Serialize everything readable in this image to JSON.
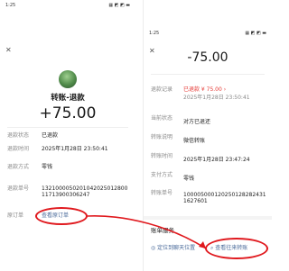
{
  "left": {
    "status_time": "1:25",
    "status_icons": "▦ ◩ ◩ ▬",
    "title": "转账-退款",
    "amount": "+75.00",
    "rows": [
      {
        "label": "退款状态",
        "value": "已退款"
      },
      {
        "label": "退款时间",
        "value": "2025年1月28日 23:50:41"
      },
      {
        "label": "退款方式",
        "value": "零钱"
      },
      {
        "label": "退款单号",
        "value": "1321000050201042025012800117139003062​47"
      },
      {
        "label": "原订单",
        "value": "查看原订单"
      }
    ]
  },
  "right": {
    "status_time": "1:25",
    "status_icons": "▦ ◩ ◩ ▬",
    "amount": "-75.00",
    "rows": [
      {
        "label": "退款记录",
        "value": "已退款 ¥ 75.00 ›",
        "sub": "2025年1月28日 23:50:41"
      },
      {
        "label": "当前状态",
        "value": "对方已退还"
      },
      {
        "label": "转账说明",
        "value": "微信转账"
      },
      {
        "label": "转账时间",
        "value": "2025年1月28日 23:47:24"
      },
      {
        "label": "支付方式",
        "value": "零钱"
      },
      {
        "label": "转账单号",
        "value": "1000050001202501282824311627601"
      }
    ],
    "section_title": "账单服务",
    "services": [
      {
        "label": "定位到聊天位置",
        "icon": "locate-icon"
      },
      {
        "label": "查看往来转账",
        "icon": "search-icon"
      }
    ]
  },
  "colors": {
    "red_annotation": "#e0191e",
    "link": "#4a6a9a",
    "refund_red": "#e53935"
  }
}
